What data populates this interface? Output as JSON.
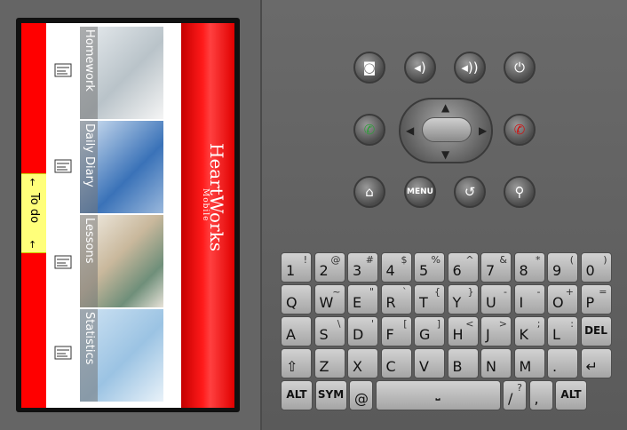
{
  "app": {
    "tiles": [
      {
        "label": "Homework",
        "bg": "linear-gradient(135deg,#e8ecef,#b9c3c9 55%,#f5f5f5)"
      },
      {
        "label": "Daily Diary",
        "bg": "linear-gradient(135deg,#d8e6f4,#3a72b8 60%,#9ab8dc)"
      },
      {
        "label": "Lessons",
        "bg": "linear-gradient(135deg,#f3efe7,#c9b89c 45%,#6f8f7a 75%,#e7e2d8)"
      },
      {
        "label": "Statistics",
        "bg": "linear-gradient(135deg,#cfe3f3,#9bc3e3 55%,#e9f2f9)"
      }
    ],
    "todo_label": "To do",
    "brand_title": "HeartWorks",
    "brand_subtitle": "Mobile",
    "help_label": "?",
    "accent": "#ff0000"
  },
  "emulator": {
    "buttons": [
      "camera-icon",
      "volume-down-icon",
      "volume-up-icon",
      "power-icon",
      "call-icon",
      "end-call-icon",
      "home-icon",
      "menu-icon",
      "back-icon",
      "search-icon"
    ],
    "menu_label": "MENU"
  },
  "keyboard": {
    "rows": [
      [
        [
          "1",
          "!"
        ],
        [
          "2",
          "@"
        ],
        [
          "3",
          "#"
        ],
        [
          "4",
          "$"
        ],
        [
          "5",
          "%"
        ],
        [
          "6",
          "^"
        ],
        [
          "7",
          "&"
        ],
        [
          "8",
          "*"
        ],
        [
          "9",
          "("
        ],
        [
          "0",
          ")"
        ]
      ],
      [
        [
          "Q",
          ""
        ],
        [
          "W",
          "~"
        ],
        [
          "E",
          "\""
        ],
        [
          "R",
          "`"
        ],
        [
          "T",
          "{"
        ],
        [
          "Y",
          "}"
        ],
        [
          "U",
          "-"
        ],
        [
          "I",
          "-"
        ],
        [
          "O",
          "+"
        ],
        [
          "P",
          "="
        ]
      ],
      [
        [
          "A",
          ""
        ],
        [
          "S",
          "\\"
        ],
        [
          "D",
          "'"
        ],
        [
          "F",
          "["
        ],
        [
          "G",
          "]"
        ],
        [
          "H",
          "<"
        ],
        [
          "J",
          ">"
        ],
        [
          "K",
          ";"
        ],
        [
          "L",
          ":"
        ],
        [
          "DEL",
          ""
        ]
      ],
      [
        [
          "⇧",
          ""
        ],
        [
          "Z",
          ""
        ],
        [
          "X",
          ""
        ],
        [
          "C",
          ""
        ],
        [
          "V",
          ""
        ],
        [
          "B",
          ""
        ],
        [
          "N",
          ""
        ],
        [
          "M",
          ""
        ],
        [
          ".",
          ""
        ],
        [
          "↵",
          ""
        ]
      ],
      [
        [
          "ALT",
          ""
        ],
        [
          "SYM",
          ""
        ],
        [
          "@",
          ""
        ],
        [
          "",
          ""
        ],
        [
          "/",
          "?"
        ],
        [
          ",",
          ""
        ],
        [
          "ALT",
          ""
        ]
      ]
    ]
  }
}
